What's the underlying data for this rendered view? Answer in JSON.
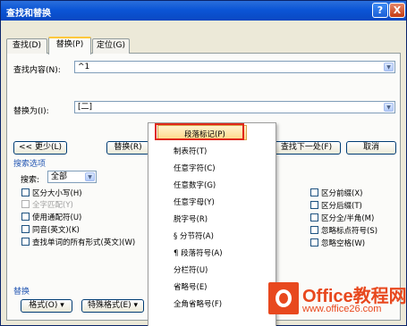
{
  "window": {
    "title": "查找和替换",
    "help_glyph": "?",
    "close_glyph": "X"
  },
  "tabs": [
    {
      "label": "查找(D)",
      "active": false
    },
    {
      "label": "替换(P)",
      "active": true
    },
    {
      "label": "定位(G)",
      "active": false
    }
  ],
  "find": {
    "label": "查找内容(N):",
    "value": "^1"
  },
  "replace": {
    "label": "替换为(I):",
    "value": "[二]"
  },
  "buttons": {
    "less": "<< 更少(L)",
    "replace": "替换(R)",
    "find_next": "查找下一处(F)",
    "cancel": "取消",
    "format": "格式(O) ▾",
    "special": "特殊格式(E) ▾"
  },
  "search_options": {
    "section_label": "搜索选项",
    "search_label": "搜索:",
    "search_value": "全部"
  },
  "checkboxes_left": [
    {
      "label": "区分大小写(H)",
      "disabled": false
    },
    {
      "label": "全字匹配(Y)",
      "disabled": true
    },
    {
      "label": "使用通配符(U)",
      "disabled": false
    },
    {
      "label": "同音(英文)(K)",
      "disabled": false
    },
    {
      "label": "查找单词的所有形式(英文)(W)",
      "disabled": false
    }
  ],
  "checkboxes_right": [
    {
      "label": "区分前缀(X)"
    },
    {
      "label": "区分后缀(T)"
    },
    {
      "label": "区分全/半角(M)"
    },
    {
      "label": "忽略标点符号(S)"
    },
    {
      "label": "忽略空格(W)"
    }
  ],
  "replace_section_label": "替换",
  "special_menu": {
    "items": [
      "段落标记(P)",
      "制表符(T)",
      "任意字符(C)",
      "任意数字(G)",
      "任意字母(Y)",
      "脱字号(R)",
      "§ 分节符(A)",
      "¶ 段落符号(A)",
      "分栏符(U)",
      "省略号(E)",
      "全角省略号(F)"
    ],
    "highlighted_index": 0
  },
  "watermark": {
    "brand": "Office教程网",
    "url": "www.office26.com"
  },
  "colors": {
    "title_bar": "#0b55d6",
    "highlight_border": "#e0281a",
    "watermark": "#e8481e"
  }
}
